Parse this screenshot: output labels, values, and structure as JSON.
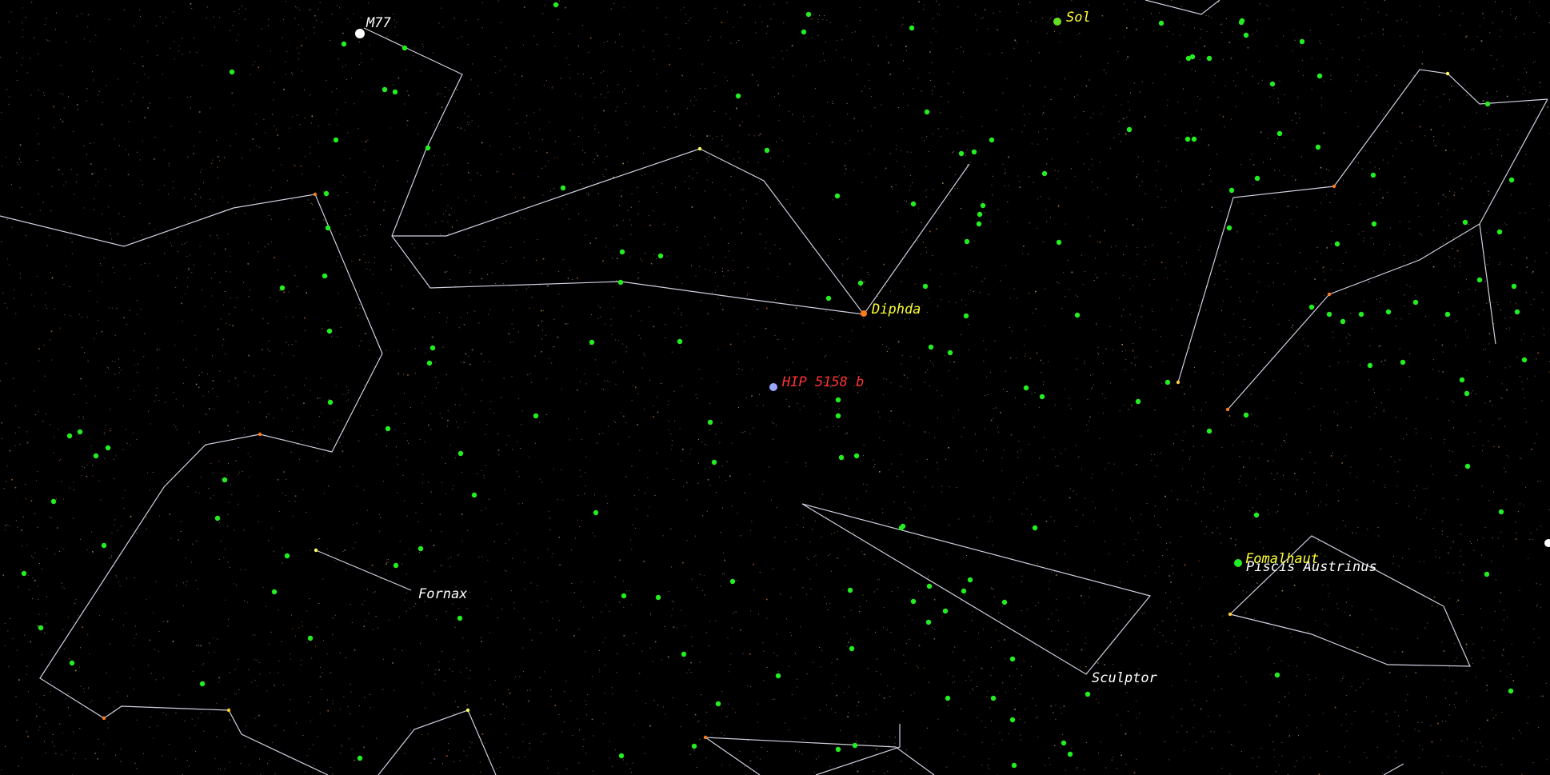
{
  "labels": {
    "dso_m77": "M77",
    "star_sol": "Sol",
    "star_diphda": "Diphda",
    "star_fomalhaut": "Fomalhaut",
    "target_planet": "HIP 5158 b",
    "const_fornax": "Fornax",
    "const_sculptor": "Sculptor",
    "const_piscis_austrinus": "Piscis Austrinus"
  },
  "colors": {
    "background": "#000000",
    "constellation_line": "#cfcfe0",
    "star_highlight": "#22ee22",
    "label_star": "#ffff33",
    "label_target": "#ff3333",
    "label_constellation": "#ffffff",
    "target_marker": "#9aa8ff",
    "diphda_marker": "#ff7a1a"
  }
}
